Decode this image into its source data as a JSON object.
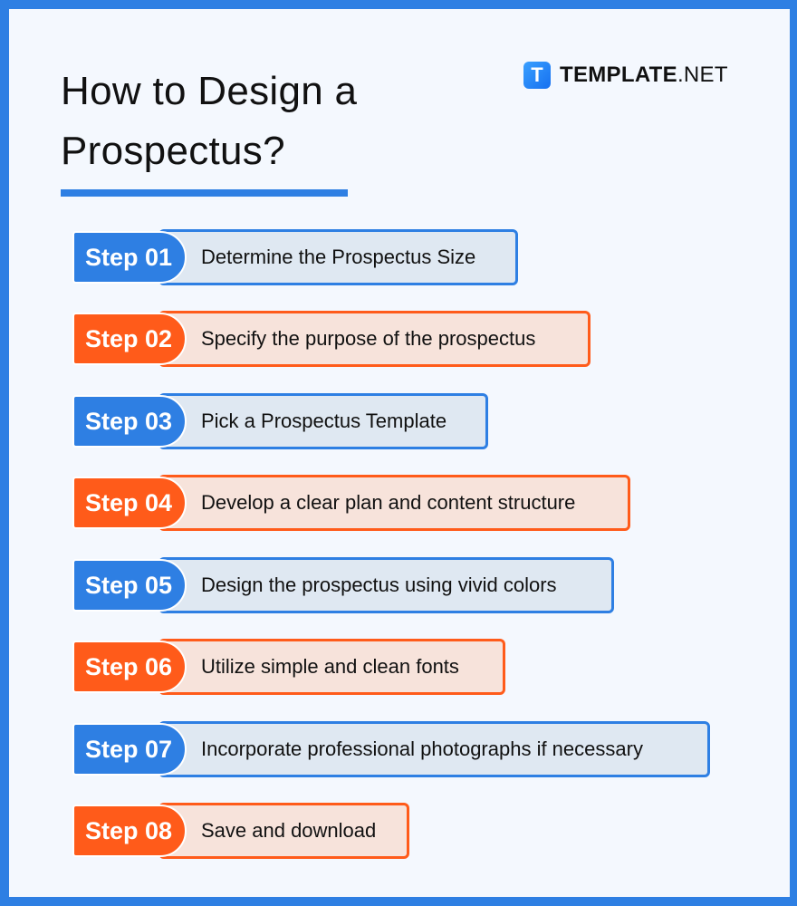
{
  "header": {
    "title_line1": "How to Design a",
    "title_line2": "Prospectus?"
  },
  "brand": {
    "badge_letter": "T",
    "name_bold": "TEMPLATE",
    "name_suffix": ".NET"
  },
  "colors": {
    "blue": "#2E7FE3",
    "orange": "#FF5B1A",
    "background": "#F4F8FE"
  },
  "steps": [
    {
      "label": "Step 01",
      "text": "Determine the Prospectus Size",
      "color": "blue"
    },
    {
      "label": "Step 02",
      "text": "Specify the purpose of the prospectus",
      "color": "orange"
    },
    {
      "label": "Step 03",
      "text": "Pick a Prospectus Template",
      "color": "blue"
    },
    {
      "label": "Step 04",
      "text": "Develop a clear plan and content structure",
      "color": "orange"
    },
    {
      "label": "Step 05",
      "text": "Design the prospectus using vivid colors",
      "color": "blue"
    },
    {
      "label": "Step 06",
      "text": "Utilize simple and clean fonts",
      "color": "orange"
    },
    {
      "label": "Step 07",
      "text": "Incorporate professional photographs if necessary",
      "color": "blue"
    },
    {
      "label": "Step 08",
      "text": "Save and download",
      "color": "orange"
    }
  ]
}
